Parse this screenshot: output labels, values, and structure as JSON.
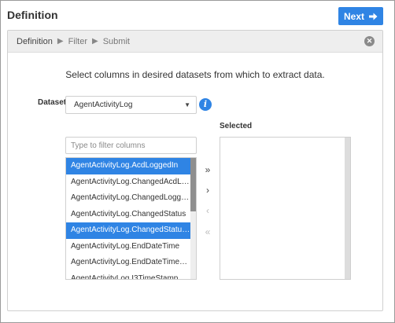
{
  "header": {
    "title": "Definition",
    "next_label": "Next",
    "next_color": "#2f84e4"
  },
  "breadcrumb": {
    "items": [
      "Definition",
      "Filter",
      "Submit"
    ],
    "separator_icon": "chevron-right-icon",
    "close_icon": "close-circle-icon"
  },
  "main": {
    "instruction": "Select columns in desired datasets from which to extract data.",
    "dataset_label": "Dataset",
    "dataset_value": "AgentActivityLog",
    "info_icon": "info-icon",
    "filter_placeholder": "Type to filter columns",
    "selected_label": "Selected",
    "columns": [
      {
        "label": "AgentActivityLog.AcdLoggedIn",
        "selected": true
      },
      {
        "label": "AgentActivityLog.ChangedAcdL…",
        "selected": false
      },
      {
        "label": "AgentActivityLog.ChangedLogg…",
        "selected": false
      },
      {
        "label": "AgentActivityLog.ChangedStatus",
        "selected": false
      },
      {
        "label": "AgentActivityLog.ChangedStatu…",
        "selected": true
      },
      {
        "label": "AgentActivityLog.EndDateTime",
        "selected": false
      },
      {
        "label": "AgentActivityLog.EndDateTime…",
        "selected": false
      },
      {
        "label": "AgentActivityLog.I3TimeStamp…",
        "selected": false
      }
    ],
    "transfer_buttons": [
      {
        "name": "move-all-right-icon",
        "glyph": "»",
        "enabled": true
      },
      {
        "name": "move-right-icon",
        "glyph": "›",
        "enabled": true
      },
      {
        "name": "move-left-icon",
        "glyph": "‹",
        "enabled": false
      },
      {
        "name": "move-all-left-icon",
        "glyph": "«",
        "enabled": false
      }
    ],
    "selected_columns": []
  }
}
